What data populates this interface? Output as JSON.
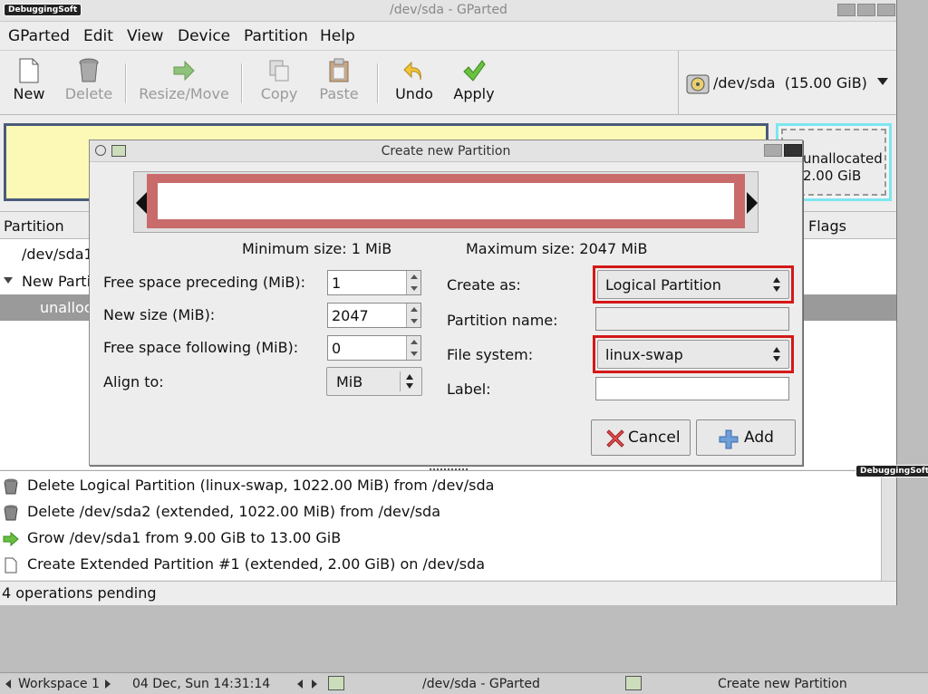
{
  "window": {
    "title": "/dev/sda - GParted",
    "brand": "DebuggingSoft"
  },
  "menubar": [
    "GParted",
    "Edit",
    "View",
    "Device",
    "Partition",
    "Help"
  ],
  "toolbar": {
    "new": "New",
    "delete": "Delete",
    "resize_move": "Resize/Move",
    "copy": "Copy",
    "paste": "Paste",
    "undo": "Undo",
    "apply": "Apply"
  },
  "device_selector": {
    "device": "/dev/sda",
    "size": "(15.00 GiB)"
  },
  "diskmap": {
    "unallocated_label": "unallocated",
    "unallocated_size": "2.00 GiB"
  },
  "partition_list": {
    "columns": [
      "Partition",
      "Flags"
    ],
    "rows": [
      {
        "name": "/dev/sda1",
        "level": 0
      },
      {
        "name": "New Partition #1",
        "level": 0
      },
      {
        "name": "unallocated",
        "level": 1
      }
    ]
  },
  "dialog": {
    "title": "Create new Partition",
    "min_size": "Minimum size: 1 MiB",
    "max_size": "Maximum size: 2047 MiB",
    "free_preceding_label": "Free space preceding (MiB):",
    "free_preceding_value": "1",
    "new_size_label": "New size (MiB):",
    "new_size_value": "2047",
    "free_following_label": "Free space following (MiB):",
    "free_following_value": "0",
    "align_label": "Align to:",
    "align_value": "MiB",
    "create_as_label": "Create as:",
    "create_as_value": "Logical Partition",
    "partition_name_label": "Partition name:",
    "partition_name_value": "",
    "file_system_label": "File system:",
    "file_system_value": "linux-swap",
    "label_label": "Label:",
    "label_value": "",
    "cancel_button": "Cancel",
    "add_button": "Add"
  },
  "operations": [
    "Delete Logical Partition (linux-swap, 1022.00 MiB) from /dev/sda",
    "Delete /dev/sda2 (extended, 1022.00 MiB) from /dev/sda",
    "Grow /dev/sda1 from 9.00 GiB to 13.00 GiB",
    "Create Extended Partition #1 (extended, 2.00 GiB) on /dev/sda"
  ],
  "status": "4 operations pending",
  "taskbar": {
    "workspace": "Workspace 1",
    "datetime": "04 Dec, Sun 14:31:14",
    "task1": "/dev/sda - GParted",
    "task2": "Create new Partition"
  },
  "colors": {
    "highlight": "#d41818",
    "primary_partition_fill": "#fcf9b6",
    "unallocated_border": "#7ee6f0",
    "size_bar": "#c96b6b"
  }
}
